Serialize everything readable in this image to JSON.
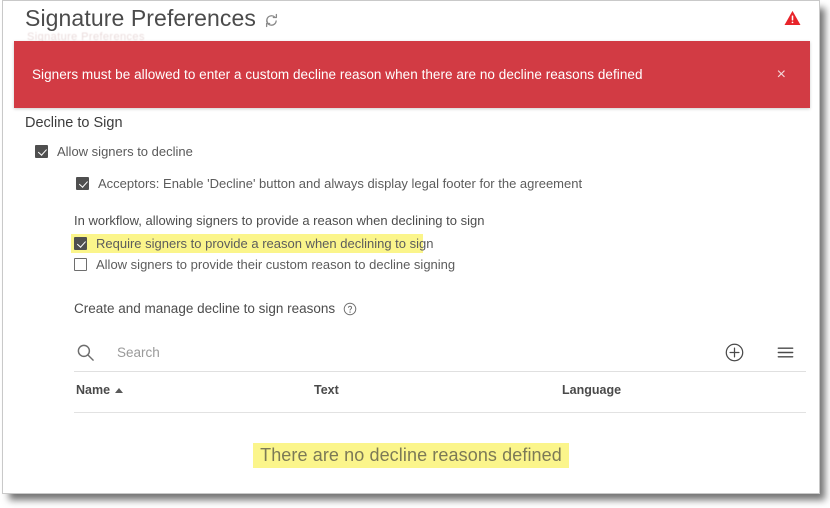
{
  "header": {
    "title": "Signature Preferences",
    "refresh_icon": "refresh-icon",
    "warning_icon": "warning-triangle-icon",
    "occluded_text": "Signature Preferences"
  },
  "alert": {
    "message": "Signers must be allowed to enter a custom decline reason when there are no decline reasons defined",
    "close_label": "×",
    "background_color": "#d23b44",
    "text_color": "#ffffff"
  },
  "section": {
    "title": "Decline to Sign",
    "workflow_note": "In workflow, allowing signers to provide a reason when declining to sign",
    "manage_label": "Create and manage decline to sign reasons",
    "help_icon": "question-mark-circle-icon"
  },
  "checkboxes": [
    {
      "label": "Allow signers to decline",
      "checked": true,
      "highlighted": false
    },
    {
      "label": "Acceptors: Enable 'Decline' button and always display legal footer for the agreement",
      "checked": true,
      "highlighted": false
    },
    {
      "label": "Require signers to provide a reason when declining to sign",
      "checked": true,
      "highlighted": true
    },
    {
      "label": "Allow signers to provide their custom reason to decline signing",
      "checked": false,
      "highlighted": false
    }
  ],
  "search": {
    "placeholder": "Search",
    "value": "",
    "icon": "magnifier-icon"
  },
  "toolbar": {
    "add_icon": "plus-circle-icon",
    "menu_icon": "hamburger-menu-icon"
  },
  "table": {
    "columns": [
      {
        "label": "Name",
        "sorted": "asc"
      },
      {
        "label": "Text",
        "sorted": "none"
      },
      {
        "label": "Language",
        "sorted": "none"
      }
    ],
    "rows": [],
    "empty_message": "There are no decline reasons defined"
  },
  "colors": {
    "alert_red": "#d23b44",
    "highlight_yellow": "#fbf58b",
    "body_text": "#5c5c5c"
  }
}
